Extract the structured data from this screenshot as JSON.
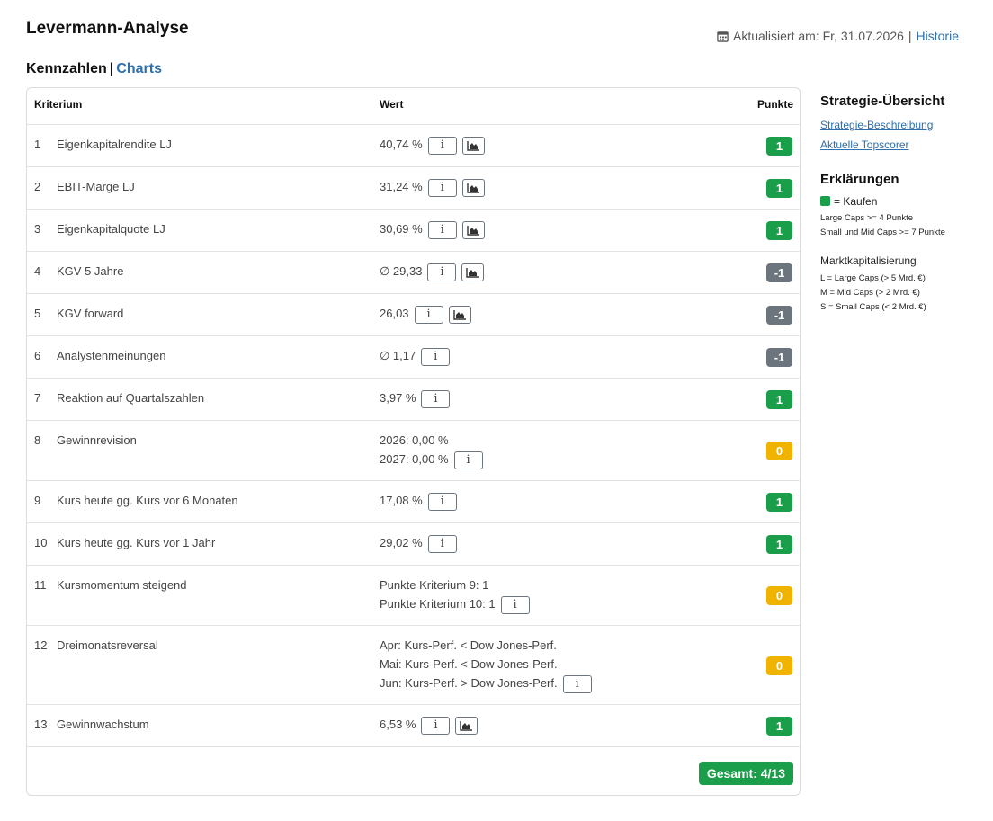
{
  "page": {
    "title": "Levermann-Analyse",
    "updated_label": "Aktualisiert am: Fr, 31.07.2026",
    "updated_sep": "|",
    "history_link": "Historie"
  },
  "section": {
    "kennzahlen": "Kennzahlen",
    "sep": "|",
    "charts": "Charts"
  },
  "table": {
    "headers": {
      "criterion": "Kriterium",
      "value": "Wert",
      "points": "Punkte"
    },
    "rows": [
      {
        "num": "1",
        "name": "Eigenkapitalrendite LJ",
        "values": [
          "40,74 %"
        ],
        "info": true,
        "chart": true,
        "points": "1",
        "color": "green"
      },
      {
        "num": "2",
        "name": "EBIT-Marge LJ",
        "values": [
          "31,24 %"
        ],
        "info": true,
        "chart": true,
        "points": "1",
        "color": "green"
      },
      {
        "num": "3",
        "name": "Eigenkapitalquote LJ",
        "values": [
          "30,69 %"
        ],
        "info": true,
        "chart": true,
        "points": "1",
        "color": "green"
      },
      {
        "num": "4",
        "name": "KGV 5 Jahre",
        "values": [
          "∅ 29,33"
        ],
        "info": true,
        "chart": true,
        "points": "-1",
        "color": "gray"
      },
      {
        "num": "5",
        "name": "KGV forward",
        "values": [
          "26,03"
        ],
        "info": true,
        "chart": true,
        "points": "-1",
        "color": "gray"
      },
      {
        "num": "6",
        "name": "Analystenmeinungen",
        "values": [
          "∅ 1,17"
        ],
        "info": true,
        "chart": false,
        "points": "-1",
        "color": "gray"
      },
      {
        "num": "7",
        "name": "Reaktion auf Quartalszahlen",
        "values": [
          "3,97 %"
        ],
        "info": true,
        "chart": false,
        "points": "1",
        "color": "green"
      },
      {
        "num": "8",
        "name": "Gewinnrevision",
        "values": [
          "2026: 0,00 %",
          "2027: 0,00 %"
        ],
        "info": true,
        "chart": false,
        "points": "0",
        "color": "yellow"
      },
      {
        "num": "9",
        "name": "Kurs heute gg. Kurs vor 6 Monaten",
        "values": [
          "17,08 %"
        ],
        "info": true,
        "chart": false,
        "points": "1",
        "color": "green"
      },
      {
        "num": "10",
        "name": "Kurs heute gg. Kurs vor 1 Jahr",
        "values": [
          "29,02 %"
        ],
        "info": true,
        "chart": false,
        "points": "1",
        "color": "green"
      },
      {
        "num": "11",
        "name": "Kursmomentum steigend",
        "values": [
          "Punkte Kriterium 9: 1",
          "Punkte Kriterium 10: 1"
        ],
        "info": true,
        "chart": false,
        "points": "0",
        "color": "yellow"
      },
      {
        "num": "12",
        "name": "Dreimonatsreversal",
        "values": [
          "Apr: Kurs-Perf. < Dow Jones-Perf.",
          "Mai: Kurs-Perf. < Dow Jones-Perf.",
          "Jun: Kurs-Perf. > Dow Jones-Perf."
        ],
        "info": true,
        "chart": false,
        "points": "0",
        "color": "yellow"
      },
      {
        "num": "13",
        "name": "Gewinnwachstum",
        "values": [
          "6,53 %"
        ],
        "info": true,
        "chart": true,
        "points": "1",
        "color": "green"
      }
    ],
    "total": "Gesamt: 4/13",
    "info_label": "i"
  },
  "sidebar": {
    "strategy_title": "Strategie-Übersicht",
    "strategy_links": [
      "Strategie-Beschreibung",
      "Aktuelle Topscorer"
    ],
    "explain_title": "Erklärungen",
    "legend_buy": "= Kaufen",
    "rules": [
      "Large Caps >= 4 Punkte",
      "Small und Mid Caps >= 7 Punkte"
    ],
    "cap_title": "Marktkapitalisierung",
    "caps": [
      "L = Large Caps (> 5 Mrd. €)",
      "M = Mid Caps (> 2 Mrd. €)",
      "S = Small Caps (< 2 Mrd. €)"
    ]
  },
  "colors": {
    "green": "#1a9e4a",
    "gray": "#6c757d",
    "yellow": "#f0b400",
    "link": "#2f6fab"
  }
}
